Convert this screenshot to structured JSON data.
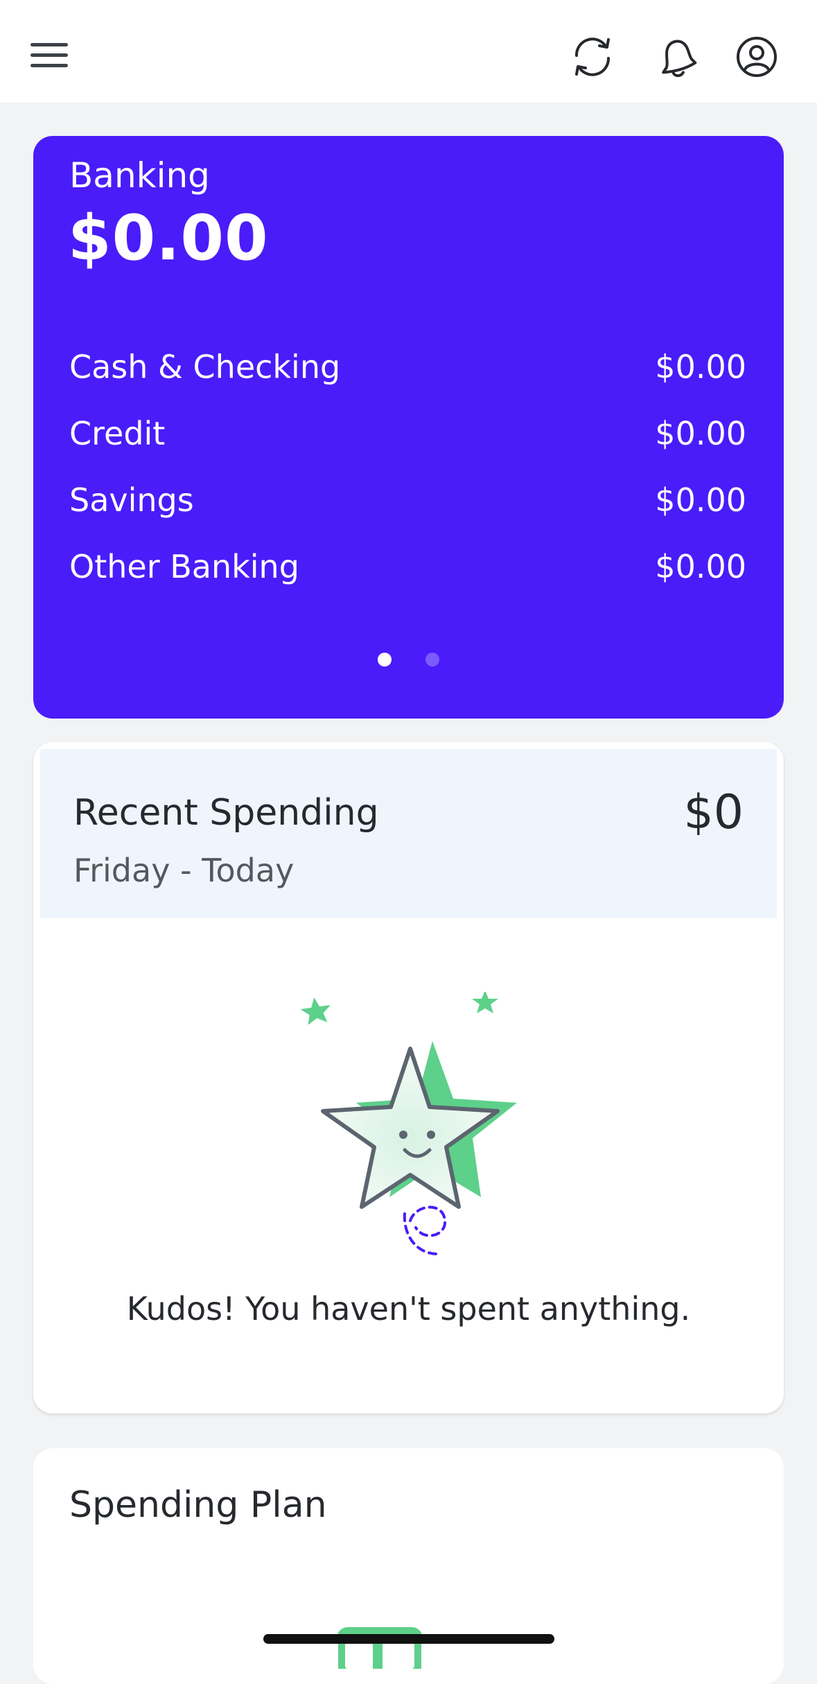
{
  "header": {
    "menu_icon": "hamburger-menu-icon",
    "refresh_icon": "refresh-icon",
    "notifications_icon": "bell-icon",
    "profile_icon": "user-circle-icon"
  },
  "banking": {
    "title": "Banking",
    "total": "$0.00",
    "rows": [
      {
        "label": "Cash & Checking",
        "amount": "$0.00"
      },
      {
        "label": "Credit",
        "amount": "$0.00"
      },
      {
        "label": "Savings",
        "amount": "$0.00"
      },
      {
        "label": "Other Banking",
        "amount": "$0.00"
      }
    ],
    "carousel": {
      "pages": 2,
      "active": 1
    },
    "color": "#4a1cf9"
  },
  "recent_spending": {
    "title": "Recent Spending",
    "period": "Friday - Today",
    "amount": "$0",
    "illustration_icon": "smiling-star-icon",
    "message": "Kudos! You haven't spent anything."
  },
  "spending_plan": {
    "title": "Spending Plan",
    "graphic_icon": "plan-chart-icon"
  },
  "colors": {
    "accent": "#4a1cf9",
    "green": "#5dd08a",
    "background": "#f2f3f5"
  }
}
